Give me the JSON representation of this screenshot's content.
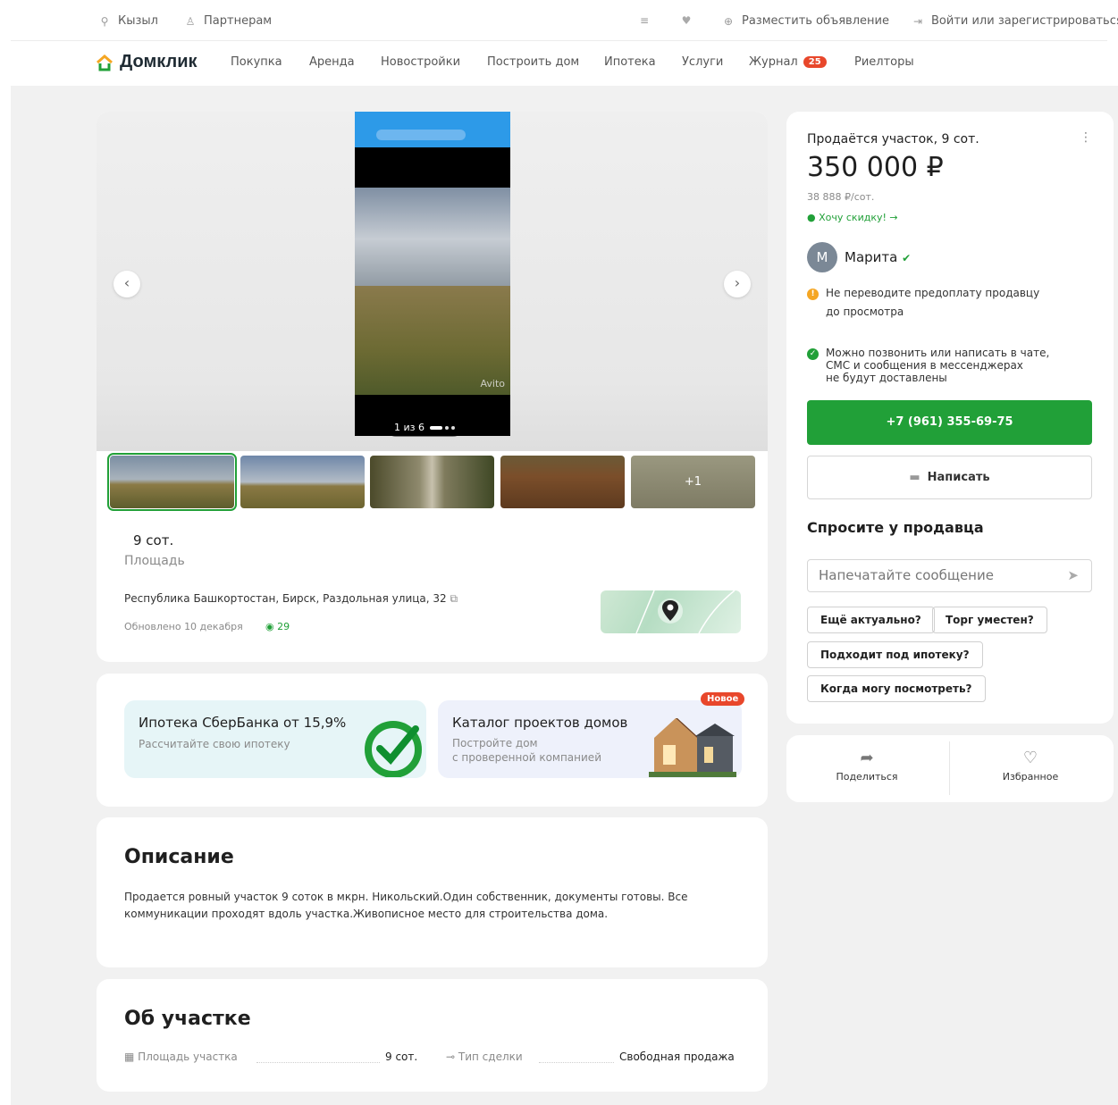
{
  "topbar": {
    "city": "Кызыл",
    "partners": "Партнерам",
    "post_ad": "Разместить объявление",
    "login": "Войти или зарегистрироваться"
  },
  "nav": {
    "logo": "Домклик",
    "items": [
      "Покупка",
      "Аренда",
      "Новостройки",
      "Построить дом",
      "Ипотека",
      "Услуги",
      "Журнал",
      "Риелторы"
    ],
    "journal_badge": "25"
  },
  "gallery": {
    "counter": "1 из 6",
    "watermark": "Avito",
    "more_photos": "+1"
  },
  "summary": {
    "area_value": "9 сот.",
    "area_label": "Площадь",
    "address": "Республика Башкортостан, Бирск, Раздольная улица, 32",
    "updated": "Обновлено 10 декабря",
    "views": "29"
  },
  "promos": {
    "mortgage_title": "Ипотека СберБанка от 15,9%",
    "mortgage_sub": "Рассчитайте свою ипотеку",
    "catalog_title": "Каталог проектов домов",
    "catalog_sub1": "Постройте дом",
    "catalog_sub2": "с проверенной компанией",
    "new_badge": "Новое"
  },
  "description": {
    "title": "Описание",
    "line1": "Продается ровный участок 9 соток в мкрн. Никольский.Один собственник, документы готовы. Все",
    "line2": "коммуникации проходят вдоль участка.Живописное место для строительства дома."
  },
  "about": {
    "title": "Об участке",
    "area_label": "Площадь участка",
    "area_value": "9 сот.",
    "deal_label": "Тип сделки",
    "deal_value": "Свободная продажа"
  },
  "offer": {
    "title": "Продаётся участок, 9 сот.",
    "price": "350 000 ₽",
    "price_per": "38 888 ₽/сот.",
    "discount": "Хочу скидку! →",
    "seller_initial": "М",
    "seller_name": "Марита",
    "warn1_l1": "Не переводите предоплату продавцу",
    "warn1_l2": "до просмотра",
    "warn2_l1": "Можно позвонить или написать в чате,",
    "warn2_l2": "СМС и сообщения в мессенджерах",
    "warn2_l3": "не будут доставлены",
    "phone": "+7 (961) 355-69-75",
    "write": "Написать",
    "ask_title": "Спросите у продавца",
    "input_placeholder": "Напечатайте сообщение",
    "chips": [
      "Ещё актуально?",
      "Торг уместен?",
      "Подходит под ипотеку?",
      "Когда могу посмотреть?"
    ]
  },
  "actions": {
    "share": "Поделиться",
    "favorite": "Избранное"
  },
  "colors": {
    "accent_green": "#21a038",
    "badge_red": "#e8472b"
  }
}
